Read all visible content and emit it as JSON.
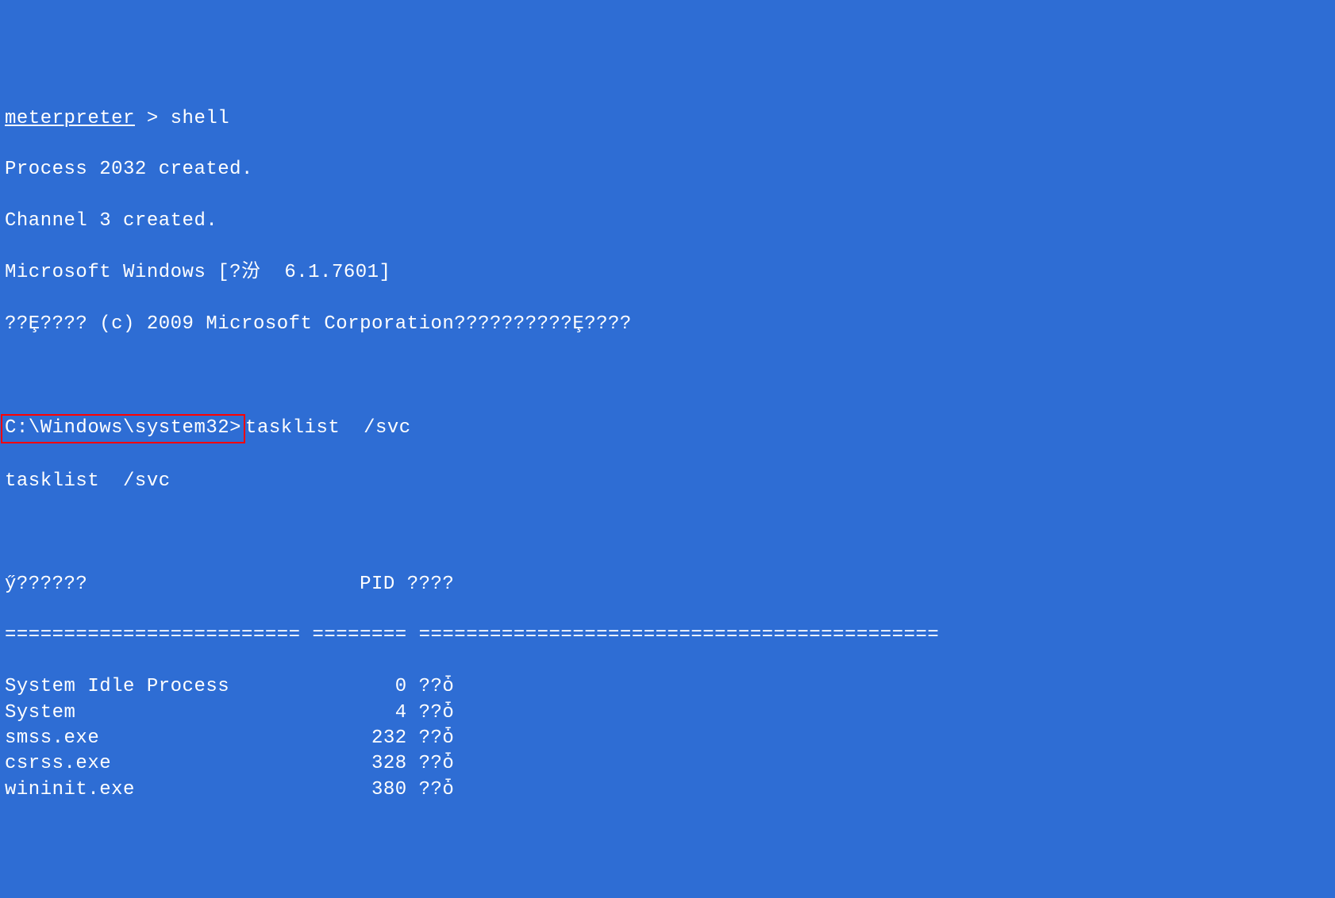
{
  "meterpreter": {
    "prompt_label": "meterpreter",
    "prompt_sep": " > ",
    "command": "shell"
  },
  "shell_init": {
    "process_line": "Process 2032 created.",
    "channel_line": "Channel 3 created.",
    "winver_line": "Microsoft Windows [?汾  6.1.7601]",
    "copyright_line": "??Ȩ???? (c) 2009 Microsoft Corporation??????????Ȩ????"
  },
  "cmd": {
    "prompt": "C:\\Windows\\system32>",
    "command": "tasklist  /svc",
    "echo": "tasklist  /svc"
  },
  "table": {
    "header_name": "ӳ??????",
    "header_pid": "PID",
    "header_svc": "????",
    "sep_name": "=========================",
    "sep_pid": "========",
    "sep_svc": "============================================",
    "rows": [
      {
        "name": "System Idle Process",
        "pid": "0",
        "svc": "??ȱ"
      },
      {
        "name": "System",
        "pid": "4",
        "svc": "??ȱ"
      },
      {
        "name": "smss.exe",
        "pid": "232",
        "svc": "??ȱ"
      },
      {
        "name": "csrss.exe",
        "pid": "328",
        "svc": "??ȱ"
      },
      {
        "name": "wininit.exe",
        "pid": "380",
        "svc": "??ȱ"
      }
    ]
  }
}
